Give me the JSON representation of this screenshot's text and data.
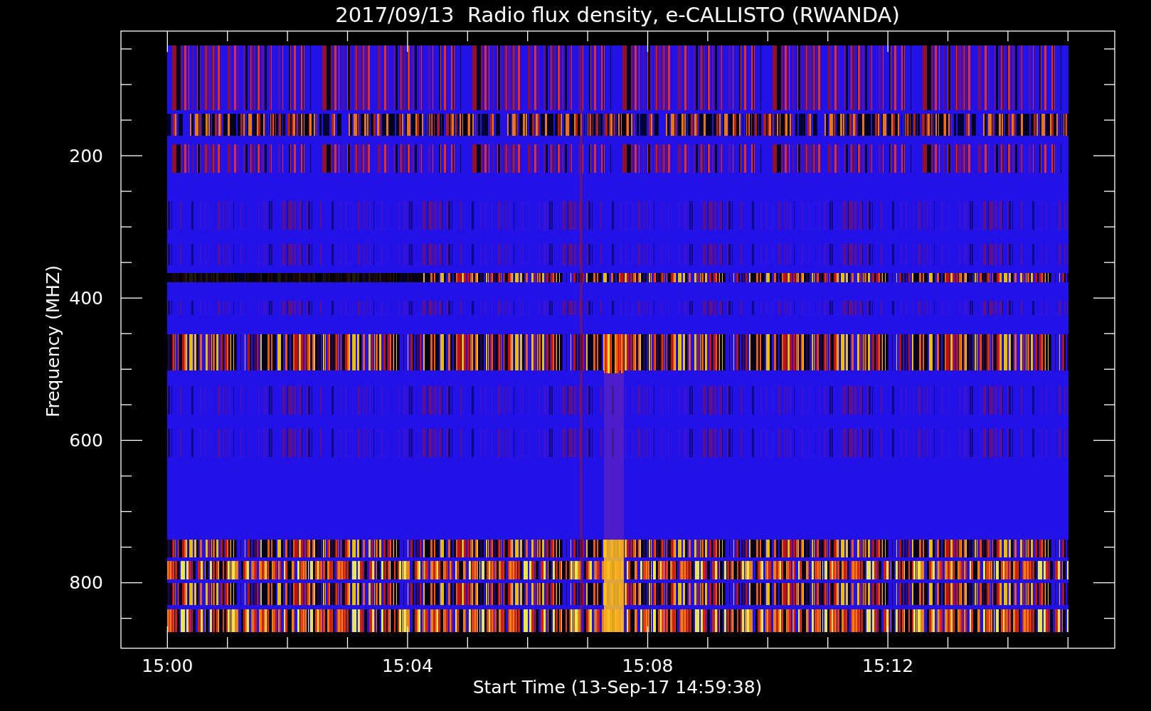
{
  "title": "2017/09/13  Radio flux density, e-CALLISTO (RWANDA)",
  "plot": {
    "ylabel": "Frequency (MHZ)",
    "xlabel": "Start Time (13-Sep-17 14:59:38)",
    "yticks": [
      "200",
      "400",
      "600",
      "800"
    ],
    "xticks": [
      "15:00",
      "15:04",
      "15:08",
      "15:12"
    ]
  }
}
